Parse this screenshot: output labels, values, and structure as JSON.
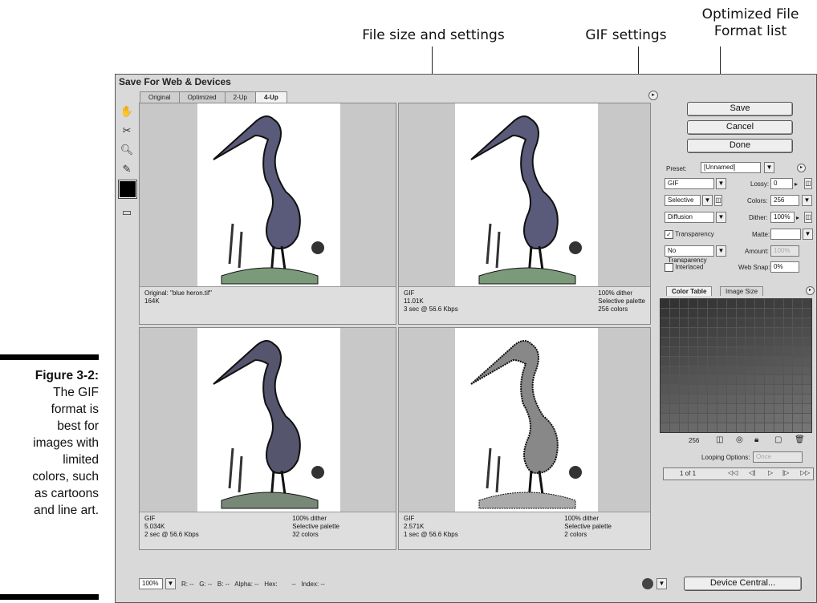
{
  "callouts": {
    "file_size": "File size and settings",
    "gif_settings": "GIF settings",
    "optimized_line1": "Optimized File",
    "optimized_line2": "Format list"
  },
  "figure": {
    "label": "Figure 3-2:",
    "line1": "The GIF",
    "line2": "format is",
    "line3": "best for",
    "line4": "images with",
    "line5": "limited",
    "line6": "colors, such",
    "line7": "as cartoons",
    "line8": "and line art."
  },
  "dialog": {
    "title": "Save For Web & Devices",
    "tabs": [
      "Original",
      "Optimized",
      "2-Up",
      "4-Up"
    ],
    "buttons": {
      "save": "Save",
      "cancel": "Cancel",
      "done": "Done",
      "device_central": "Device Central..."
    }
  },
  "panes": [
    {
      "left1": "Original: \"blue heron.tif\"",
      "left2": "164K",
      "left3": "",
      "right1": "",
      "right2": "",
      "right3": ""
    },
    {
      "left1": "GIF",
      "left2": "11.01K",
      "left3": "3 sec @ 56.6 Kbps",
      "right1": "100% dither",
      "right2": "Selective palette",
      "right3": "256 colors"
    },
    {
      "left1": "GIF",
      "left2": "5.034K",
      "left3": "2 sec @ 56.6 Kbps",
      "right1": "100% dither",
      "right2": "Selective palette",
      "right3": "32 colors"
    },
    {
      "left1": "GIF",
      "left2": "2.571K",
      "left3": "1 sec @ 56.6 Kbps",
      "right1": "100% dither",
      "right2": "Selective palette",
      "right3": "2 colors"
    }
  ],
  "settings": {
    "preset_label": "Preset:",
    "preset_value": "[Unnamed]",
    "format": "GIF",
    "reduction": "Selective",
    "dither_algo": "Diffusion",
    "transparency_label": "Transparency",
    "transparency_dither": "No Transparency ...",
    "interlaced_label": "Interlaced",
    "lossy_label": "Lossy:",
    "lossy_value": "0",
    "colors_label": "Colors:",
    "colors_value": "256",
    "dither_label": "Dither:",
    "dither_value": "100%",
    "matte_label": "Matte:",
    "amount_label": "Amount:",
    "amount_value": "100%",
    "websnap_label": "Web Snap:",
    "websnap_value": "0%"
  },
  "color_table": {
    "tab1": "Color Table",
    "tab2": "Image Size",
    "count": "256",
    "looping_label": "Looping Options:",
    "looping_value": "Once",
    "frame": "1 of 1"
  },
  "statusbar": {
    "zoom": "100%",
    "r": "R:",
    "g": "G:",
    "b": "B:",
    "alpha": "Alpha:",
    "hex": "Hex:",
    "index": "Index:",
    "dash": "--"
  }
}
